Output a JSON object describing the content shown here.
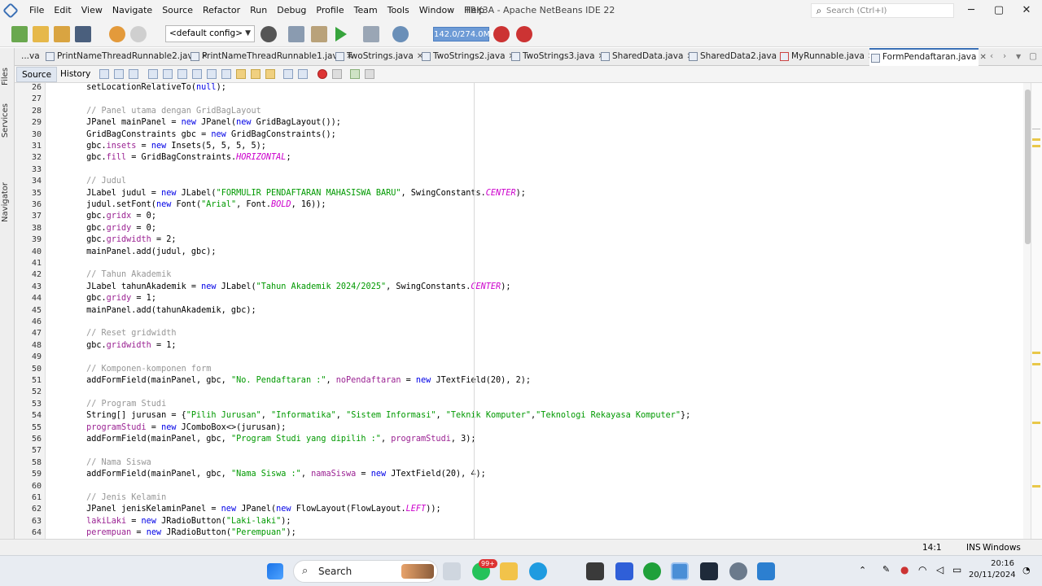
{
  "menubar": {
    "items": [
      "File",
      "Edit",
      "View",
      "Navigate",
      "Source",
      "Refactor",
      "Run",
      "Debug",
      "Profile",
      "Team",
      "Tools",
      "Window",
      "Help"
    ],
    "window_title": "TRK3A - Apache NetBeans IDE 22",
    "search_placeholder": "Search (Ctrl+I)",
    "minimize": "─",
    "maximize": "▢",
    "close": "✕"
  },
  "toolbar": {
    "config_value": "<default config>",
    "memory": "142.0/274.0MB"
  },
  "tabs": [
    {
      "label": "...va"
    },
    {
      "label": "PrintNameThreadRunnable2.java"
    },
    {
      "label": "PrintNameThreadRunnable1.java"
    },
    {
      "label": "TwoStrings.java"
    },
    {
      "label": "TwoStrings2.java"
    },
    {
      "label": "TwoStrings3.java"
    },
    {
      "label": "SharedData.java"
    },
    {
      "label": "SharedData2.java"
    },
    {
      "label": "MyRunnable.java"
    },
    {
      "label": "FormPendaftaran.java"
    }
  ],
  "side": {
    "files": "Files",
    "services": "Services",
    "navigator": "Navigator"
  },
  "editor": {
    "source_tab": "Source",
    "history_tab": "History",
    "lines": [
      {
        "n": "26",
        "t": [
          [
            "",
            "        setLocationRelativeTo("
          ],
          [
            "kw",
            "null"
          ],
          [
            "",
            ");"
          ]
        ]
      },
      {
        "n": "27",
        "t": []
      },
      {
        "n": "28",
        "t": [
          [
            "cm",
            "        // Panel utama dengan GridBagLayout"
          ]
        ]
      },
      {
        "n": "29",
        "t": [
          [
            "",
            "        JPanel mainPanel = "
          ],
          [
            "kw",
            "new"
          ],
          [
            "",
            " JPanel("
          ],
          [
            "kw",
            "new"
          ],
          [
            "",
            " GridBagLayout());"
          ]
        ]
      },
      {
        "n": "30",
        "t": [
          [
            "",
            "        GridBagConstraints gbc = "
          ],
          [
            "kw",
            "new"
          ],
          [
            "",
            " GridBagConstraints();"
          ]
        ]
      },
      {
        "n": "31",
        "t": [
          [
            "",
            "        gbc."
          ],
          [
            "pf",
            "insets"
          ],
          [
            "",
            " = "
          ],
          [
            "kw",
            "new"
          ],
          [
            "",
            " Insets(5, 5, 5, 5);"
          ]
        ]
      },
      {
        "n": "32",
        "t": [
          [
            "",
            "        gbc."
          ],
          [
            "pf",
            "fill"
          ],
          [
            "",
            " = GridBagConstraints."
          ],
          [
            "it",
            "HORIZONTAL"
          ],
          [
            "",
            ";"
          ]
        ]
      },
      {
        "n": "33",
        "t": []
      },
      {
        "n": "34",
        "t": [
          [
            "cm",
            "        // Judul"
          ]
        ]
      },
      {
        "n": "35",
        "t": [
          [
            "",
            "        JLabel judul = "
          ],
          [
            "kw",
            "new"
          ],
          [
            "",
            " JLabel("
          ],
          [
            "fd",
            "\"FORMULIR PENDAFTARAN MAHASISWA BARU\""
          ],
          [
            "",
            ", SwingConstants."
          ],
          [
            "it",
            "CENTER"
          ],
          [
            "",
            ");"
          ]
        ]
      },
      {
        "n": "36",
        "t": [
          [
            "",
            "        judul.setFont("
          ],
          [
            "kw",
            "new"
          ],
          [
            "",
            " Font("
          ],
          [
            "fd",
            "\"Arial\""
          ],
          [
            "",
            ", Font."
          ],
          [
            "it",
            "BOLD"
          ],
          [
            "",
            ", 16));"
          ]
        ]
      },
      {
        "n": "37",
        "t": [
          [
            "",
            "        gbc."
          ],
          [
            "pf",
            "gridx"
          ],
          [
            "",
            " = 0;"
          ]
        ]
      },
      {
        "n": "38",
        "t": [
          [
            "",
            "        gbc."
          ],
          [
            "pf",
            "gridy"
          ],
          [
            "",
            " = 0;"
          ]
        ]
      },
      {
        "n": "39",
        "t": [
          [
            "",
            "        gbc."
          ],
          [
            "pf",
            "gridwidth"
          ],
          [
            "",
            " = 2;"
          ]
        ]
      },
      {
        "n": "40",
        "t": [
          [
            "",
            "        mainPanel.add(judul, gbc);"
          ]
        ]
      },
      {
        "n": "41",
        "t": []
      },
      {
        "n": "42",
        "t": [
          [
            "cm",
            "        // Tahun Akademik"
          ]
        ]
      },
      {
        "n": "43",
        "t": [
          [
            "",
            "        JLabel tahunAkademik = "
          ],
          [
            "kw",
            "new"
          ],
          [
            "",
            " JLabel("
          ],
          [
            "fd",
            "\"Tahun Akademik 2024/2025\""
          ],
          [
            "",
            ", SwingConstants."
          ],
          [
            "it",
            "CENTER"
          ],
          [
            "",
            ");"
          ]
        ]
      },
      {
        "n": "44",
        "t": [
          [
            "",
            "        gbc."
          ],
          [
            "pf",
            "gridy"
          ],
          [
            "",
            " = 1;"
          ]
        ]
      },
      {
        "n": "45",
        "t": [
          [
            "",
            "        mainPanel.add(tahunAkademik, gbc);"
          ]
        ]
      },
      {
        "n": "46",
        "t": []
      },
      {
        "n": "47",
        "t": [
          [
            "cm",
            "        // Reset gridwidth"
          ]
        ]
      },
      {
        "n": "48",
        "t": [
          [
            "",
            "        gbc."
          ],
          [
            "pf",
            "gridwidth"
          ],
          [
            "",
            " = 1;"
          ]
        ]
      },
      {
        "n": "49",
        "t": []
      },
      {
        "n": "50",
        "t": [
          [
            "cm",
            "        // Komponen-komponen form"
          ]
        ]
      },
      {
        "n": "51",
        "t": [
          [
            "",
            "        addFormField(mainPanel, gbc, "
          ],
          [
            "fd",
            "\"No. Pendaftaran :\""
          ],
          [
            "",
            ", "
          ],
          [
            "pf",
            "noPendaftaran"
          ],
          [
            "",
            " = "
          ],
          [
            "kw",
            "new"
          ],
          [
            "",
            " JTextField(20), 2);"
          ]
        ]
      },
      {
        "n": "52",
        "t": []
      },
      {
        "n": "53",
        "t": [
          [
            "cm",
            "        // Program Studi"
          ]
        ]
      },
      {
        "n": "54",
        "t": [
          [
            "",
            "        String[] jurusan = {"
          ],
          [
            "fd",
            "\"Pilih Jurusan\""
          ],
          [
            "",
            ", "
          ],
          [
            "fd",
            "\"Informatika\""
          ],
          [
            "",
            ", "
          ],
          [
            "fd",
            "\"Sistem Informasi\""
          ],
          [
            "",
            ", "
          ],
          [
            "fd",
            "\"Teknik Komputer\""
          ],
          [
            "",
            ","
          ],
          [
            "fd",
            "\"Teknologi Rekayasa Komputer\""
          ],
          [
            "",
            "};"
          ]
        ]
      },
      {
        "n": "55",
        "t": [
          [
            "pf",
            "        programStudi"
          ],
          [
            "",
            " = "
          ],
          [
            "kw",
            "new"
          ],
          [
            "",
            " JComboBox<>(jurusan);"
          ]
        ]
      },
      {
        "n": "56",
        "t": [
          [
            "",
            "        addFormField(mainPanel, gbc, "
          ],
          [
            "fd",
            "\"Program Studi yang dipilih :\""
          ],
          [
            "",
            ", "
          ],
          [
            "pf",
            "programStudi"
          ],
          [
            "",
            ", 3);"
          ]
        ]
      },
      {
        "n": "57",
        "t": []
      },
      {
        "n": "58",
        "t": [
          [
            "cm",
            "        // Nama Siswa"
          ]
        ]
      },
      {
        "n": "59",
        "t": [
          [
            "",
            "        addFormField(mainPanel, gbc, "
          ],
          [
            "fd",
            "\"Nama Siswa :\""
          ],
          [
            "",
            ", "
          ],
          [
            "pf",
            "namaSiswa"
          ],
          [
            "",
            " = "
          ],
          [
            "kw",
            "new"
          ],
          [
            "",
            " JTextField(20), 4);"
          ]
        ]
      },
      {
        "n": "60",
        "t": []
      },
      {
        "n": "61",
        "t": [
          [
            "cm",
            "        // Jenis Kelamin"
          ]
        ]
      },
      {
        "n": "62",
        "t": [
          [
            "",
            "        JPanel jenisKelaminPanel = "
          ],
          [
            "kw",
            "new"
          ],
          [
            "",
            " JPanel("
          ],
          [
            "kw",
            "new"
          ],
          [
            "",
            " FlowLayout(FlowLayout."
          ],
          [
            "it",
            "LEFT"
          ],
          [
            "",
            "));"
          ]
        ]
      },
      {
        "n": "63",
        "t": [
          [
            "pf",
            "        lakiLaki"
          ],
          [
            "",
            " = "
          ],
          [
            "kw",
            "new"
          ],
          [
            "",
            " JRadioButton("
          ],
          [
            "fd",
            "\"Laki-laki\""
          ],
          [
            "",
            ");"
          ]
        ]
      },
      {
        "n": "64",
        "t": [
          [
            "pf",
            "        perempuan"
          ],
          [
            "",
            " = "
          ],
          [
            "kw",
            "new"
          ],
          [
            "",
            " JRadioButton("
          ],
          [
            "fd",
            "\"Perempuan\""
          ],
          [
            "",
            ");"
          ]
        ]
      }
    ]
  },
  "status": {
    "position": "14:1",
    "mode": "INS",
    "line_ending": "Windows (CRLF)"
  },
  "taskbar": {
    "search": "Search",
    "badge": "99+",
    "time": "20:16",
    "date": "20/11/2024"
  }
}
